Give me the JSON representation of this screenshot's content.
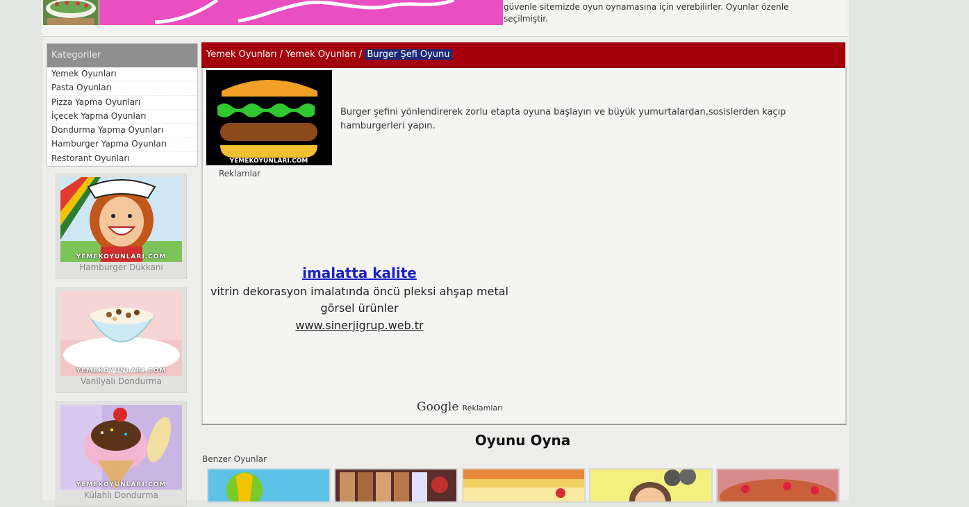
{
  "header": {
    "description": "güvenle sitemizde oyun oynamasına için verebilirler. Oyunlar özenle seçilmiştir."
  },
  "sidebar": {
    "categories_title": "Kategoriler",
    "categories": [
      "Yemek Oyunları",
      "Pasta Oyunları",
      "Pizza Yapma Oyunları",
      "İçecek Yapma Oyunları",
      "Dondurma Yapma Oyunları",
      "Hamburger Yapma Oyunları",
      "Restorant Oyunları"
    ],
    "featured_games": [
      {
        "caption": "Hamburger Dükkanı"
      },
      {
        "caption": "Vanilyalı Dondurma"
      },
      {
        "caption": "Külahlı Dondurma"
      }
    ],
    "watermark": "YEMEKOYUNLARI.COM"
  },
  "breadcrumb": {
    "items": [
      "Yemek Oyunları",
      "Yemek Oyunları"
    ],
    "separator": "/",
    "current": "Burger Şefi Oyunu"
  },
  "game": {
    "description": "Burger şefini yönlendirerek zorlu etapta oyuna başlayın ve büyük yumurtalardan,sosislerden kaçıp hamburgerleri yapın.",
    "image_watermark": "YEMEKOYUNLARI.COM"
  },
  "ads": {
    "label": "Reklamlar",
    "title": "imalatta kalite",
    "text": "vitrin dekorasyon imalatında öncü pleksi ahşap metal görsel ürünler",
    "url": "www.sinerjigrup.web.tr",
    "google_word": "Google",
    "google_label": "Reklamları"
  },
  "play": {
    "title": "Oyunu Oyna",
    "similar_label": "Benzer Oyunlar"
  },
  "colors": {
    "breadcrumb_bar": "#a3000c",
    "breadcrumb_current": "#1d2a7a",
    "ad_link": "#1a1fc0",
    "banner_pink": "#e94fc0"
  }
}
